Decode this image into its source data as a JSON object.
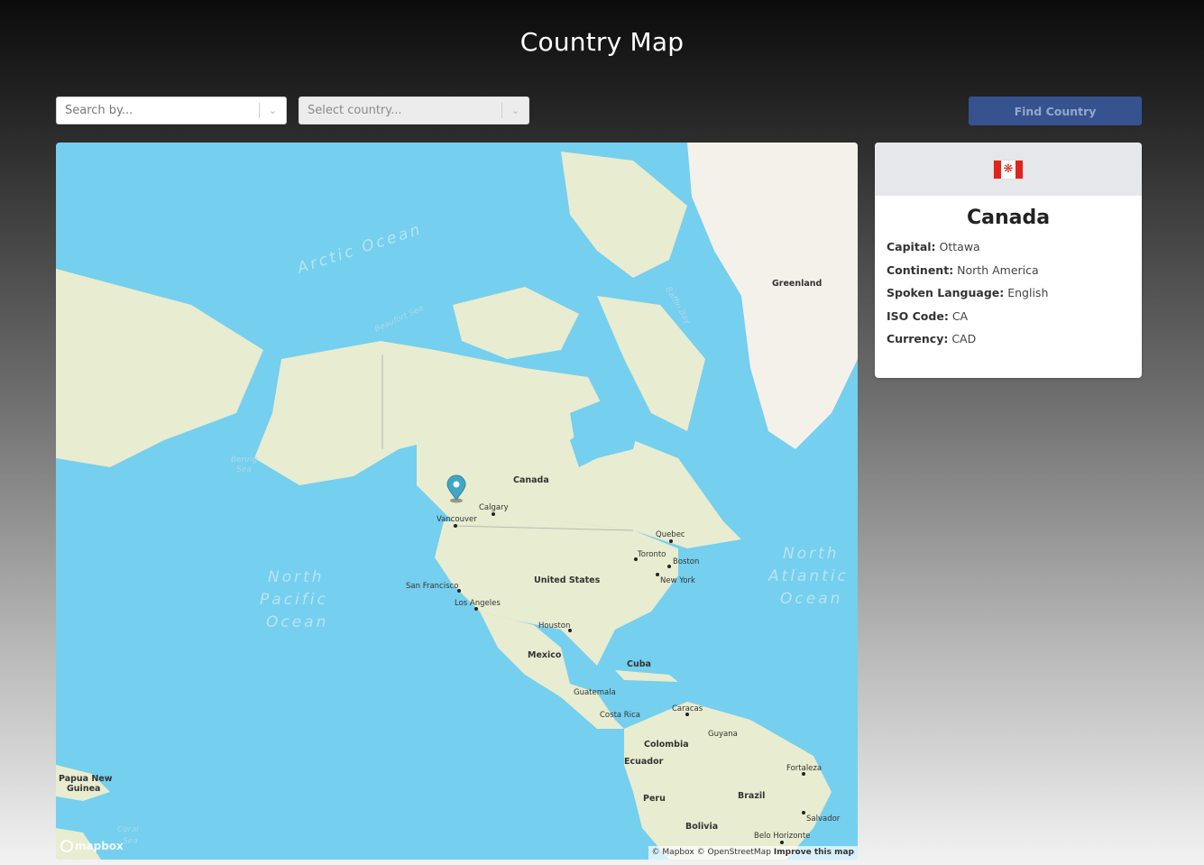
{
  "header": {
    "title": "Country Map"
  },
  "controls": {
    "search_placeholder": "Search by...",
    "country_placeholder": "Select country...",
    "find_label": "Find Country"
  },
  "map": {
    "ocean_labels": [
      "Arctic Ocean",
      "North",
      "Pacific",
      "Ocean",
      "North",
      "Atlantic",
      "Ocean"
    ],
    "sea_labels": [
      "Beaufort Sea",
      "Baffin Bay",
      "Bering",
      "Sea",
      "Coral",
      "Sea"
    ],
    "country_labels": [
      "Greenland",
      "Canada",
      "United States",
      "Mexico",
      "Cuba",
      "Brazil",
      "Colombia",
      "Ecuador",
      "Peru",
      "Bolivia",
      "Papua New",
      "Guinea",
      "Guatemala",
      "Costa Rica"
    ],
    "city_labels": [
      "Calgary",
      "Vancouver",
      "Quebec",
      "Toronto",
      "Boston",
      "New York",
      "San Francisco",
      "Los Angeles",
      "Houston",
      "Caracas",
      "Guyana",
      "Fortaleza",
      "Salvador",
      "Belo Horizonte"
    ],
    "attribution": [
      "© Mapbox",
      "© OpenStreetMap",
      "Improve this map"
    ],
    "logo_text": "mapbox",
    "marker_color": "#3fa6c4"
  },
  "country": {
    "flag": "maple-leaf-flag",
    "name": "Canada",
    "facts": [
      {
        "label": "Capital:",
        "value": "Ottawa"
      },
      {
        "label": "Continent:",
        "value": "North America"
      },
      {
        "label": "Spoken Language:",
        "value": "English"
      },
      {
        "label": "ISO Code:",
        "value": "CA"
      },
      {
        "label": "Currency:",
        "value": "CAD"
      }
    ]
  }
}
